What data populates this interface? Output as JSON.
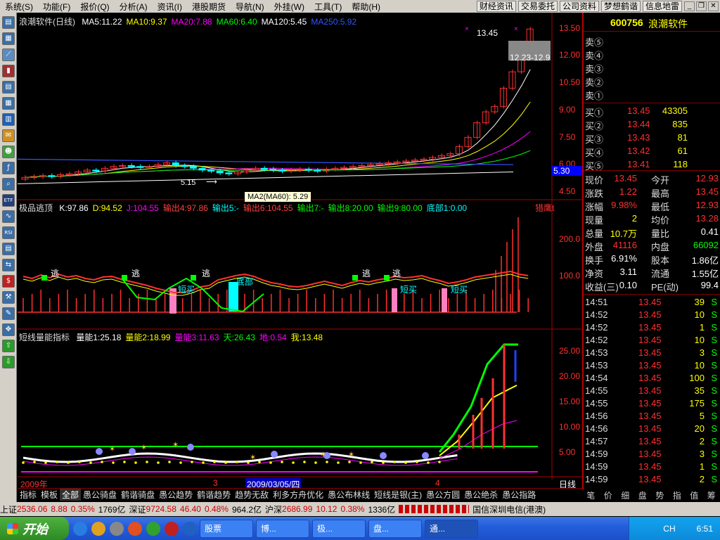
{
  "menubar": {
    "items": [
      "系统(S)",
      "功能(F)",
      "报价(Q)",
      "分析(A)",
      "资讯(I)",
      "港股期货",
      "导航(N)",
      "外挂(W)",
      "工具(T)",
      "帮助(H)"
    ],
    "buttons": [
      "财经资讯",
      "交易委托",
      "公司资料",
      "梦想鹤谐",
      "信息地雷"
    ]
  },
  "main_chart": {
    "title": "浪潮软件(日线)",
    "ma_labels": [
      {
        "text": "MA5:11.22",
        "color": "#ffffff"
      },
      {
        "text": "MA10:9.37",
        "color": "#ffff00"
      },
      {
        "text": "MA20:7.88",
        "color": "#ff00ff"
      },
      {
        "text": "MA60:6.40",
        "color": "#00ff00"
      },
      {
        "text": "MA120:5.45",
        "color": "#ffffff"
      },
      {
        "text": "MA250:5.92",
        "color": "#3355ff"
      }
    ],
    "y_ticks": [
      "13.50",
      "12.00",
      "10.50",
      "9.00",
      "7.50",
      "6.00",
      "4.50"
    ],
    "high_label": "13.45",
    "range_label": "12.23-12.9",
    "low_label": "5.15",
    "price_tag": "5.30",
    "tooltip": "MA2(MA60): 5.29"
  },
  "indicator1": {
    "title": "极品逃顶",
    "labels": [
      {
        "text": "K:97.86",
        "color": "#ffffff"
      },
      {
        "text": "D:94.52",
        "color": "#ffff00"
      },
      {
        "text": "J:104.55",
        "color": "#ff00ff"
      },
      {
        "text": "输出4:97.86",
        "color": "#ff4040"
      },
      {
        "text": "输出5:-",
        "color": "#00ffff"
      },
      {
        "text": "输出6:104.55",
        "color": "#ff4040"
      },
      {
        "text": "输出7:-",
        "color": "#00ff00"
      },
      {
        "text": "输出8:20.00",
        "color": "#00ff00"
      },
      {
        "text": "输出9:80.00",
        "color": "#00ff00"
      },
      {
        "text": "底部1:0.00",
        "color": "#00ffff"
      }
    ],
    "right_label": "猎鹰t",
    "y_ticks": [
      "200.0",
      "100.0"
    ],
    "escape_label": "逃",
    "buy_label": "短买",
    "bottom_label": "底部"
  },
  "indicator2": {
    "title": "短线量能指标",
    "labels": [
      {
        "text": "量能1:25.18",
        "color": "#ffffff"
      },
      {
        "text": "量能2:18.99",
        "color": "#ffff00"
      },
      {
        "text": "量能3:11.63",
        "color": "#ff00ff"
      },
      {
        "text": "天:26.43",
        "color": "#00ff00"
      },
      {
        "text": "地:0.54",
        "color": "#ff00ff"
      },
      {
        "text": "我:13.48",
        "color": "#ffff00"
      }
    ],
    "y_ticks": [
      "25.00",
      "20.00",
      "15.00",
      "10.00",
      "5.00"
    ]
  },
  "timeline": {
    "left": "2009年",
    "mark3": "3",
    "mark4": "4",
    "cursor": "2009/03/05/四",
    "period": "日线"
  },
  "tabs": [
    "指标",
    "模板",
    "全部",
    "愚公骑盘",
    "鹤谐骑盘",
    "愚公趋势",
    "鹤谐趋势",
    "趋势无敌",
    "利多方舟优化",
    "愚公布林线",
    "短线是银(主)",
    "愚公方圆",
    "愚公绝杀",
    "愚公指路"
  ],
  "quote": {
    "code": "600756",
    "name": "浪潮软件",
    "sells": [
      "卖⑤",
      "卖④",
      "卖③",
      "卖②",
      "卖①"
    ],
    "buys": [
      {
        "label": "买①",
        "price": "13.45",
        "vol": "43305"
      },
      {
        "label": "买②",
        "price": "13.44",
        "vol": "835"
      },
      {
        "label": "买③",
        "price": "13.43",
        "vol": "81"
      },
      {
        "label": "买④",
        "price": "13.42",
        "vol": "61"
      },
      {
        "label": "买⑤",
        "price": "13.41",
        "vol": "118"
      }
    ],
    "stats": [
      {
        "l1": "现价",
        "v1": "13.45",
        "c1": "#ff3030",
        "l2": "今开",
        "v2": "12.93",
        "c2": "#ff3030"
      },
      {
        "l1": "涨跌",
        "v1": "1.22",
        "c1": "#ff3030",
        "l2": "最高",
        "v2": "13.45",
        "c2": "#ff3030"
      },
      {
        "l1": "涨幅",
        "v1": "9.98%",
        "c1": "#ff3030",
        "l2": "最低",
        "v2": "12.93",
        "c2": "#ff3030"
      },
      {
        "l1": "现量",
        "v1": "2",
        "c1": "#ffff00",
        "l2": "均价",
        "v2": "13.28",
        "c2": "#ff3030"
      },
      {
        "l1": "总量",
        "v1": "10.7万",
        "c1": "#ffff00",
        "l2": "量比",
        "v2": "0.41",
        "c2": "#ffffff"
      },
      {
        "l1": "外盘",
        "v1": "41116",
        "c1": "#ff3030",
        "l2": "内盘",
        "v2": "66092",
        "c2": "#00ff00"
      },
      {
        "l1": "换手",
        "v1": "6.91%",
        "c1": "#ffffff",
        "l2": "股本",
        "v2": "1.86亿",
        "c2": "#ffffff"
      },
      {
        "l1": "净资",
        "v1": "3.11",
        "c1": "#ffffff",
        "l2": "流通",
        "v2": "1.55亿",
        "c2": "#ffffff"
      },
      {
        "l1": "收益(三)",
        "v1": "0.10",
        "c1": "#ffffff",
        "l2": "PE(动)",
        "v2": "99.4",
        "c2": "#ffffff"
      }
    ],
    "ticks": [
      {
        "t": "14:51",
        "p": "13.45",
        "v": "39",
        "s": "S"
      },
      {
        "t": "14:52",
        "p": "13.45",
        "v": "10",
        "s": "S"
      },
      {
        "t": "14:52",
        "p": "13.45",
        "v": "1",
        "s": "S"
      },
      {
        "t": "14:52",
        "p": "13.45",
        "v": "10",
        "s": "S"
      },
      {
        "t": "14:53",
        "p": "13.45",
        "v": "3",
        "s": "S"
      },
      {
        "t": "14:53",
        "p": "13.45",
        "v": "10",
        "s": "S"
      },
      {
        "t": "14:54",
        "p": "13.45",
        "v": "100",
        "s": "S"
      },
      {
        "t": "14:55",
        "p": "13.45",
        "v": "35",
        "s": "S"
      },
      {
        "t": "14:55",
        "p": "13.45",
        "v": "175",
        "s": "S"
      },
      {
        "t": "14:56",
        "p": "13.45",
        "v": "5",
        "s": "S"
      },
      {
        "t": "14:56",
        "p": "13.45",
        "v": "20",
        "s": "S"
      },
      {
        "t": "14:57",
        "p": "13.45",
        "v": "2",
        "s": "S"
      },
      {
        "t": "14:59",
        "p": "13.45",
        "v": "3",
        "s": "S"
      },
      {
        "t": "14:59",
        "p": "13.45",
        "v": "1",
        "s": "S"
      },
      {
        "t": "14:59",
        "p": "13.45",
        "v": "2",
        "s": "S"
      }
    ],
    "right_tabs": [
      "笔",
      "价",
      "细",
      "盘",
      "势",
      "指",
      "值",
      "筹"
    ]
  },
  "statusbar": {
    "sh_label": "上证",
    "sh_val": "2536.06",
    "sh_chg": "8.88",
    "sh_pct": "0.35%",
    "sh_amt": "1769亿",
    "sz_label": "深证",
    "sz_val": "9724.58",
    "sz_chg": "46.40",
    "sz_pct": "0.48%",
    "sz_amt": "964.2亿",
    "hs_label": "沪深",
    "hs_val": "2686.99",
    "hs_chg": "10.12",
    "hs_pct": "0.38%",
    "hs_amt": "1336亿",
    "conn": "国信深圳电信(港澳)"
  },
  "taskbar": {
    "start": "开始",
    "tasks": [
      "股票",
      "博...",
      "极...",
      "盘...",
      "通..."
    ],
    "lang": "CH",
    "clock": "6:51"
  },
  "chart_data": {
    "type": "candlestick",
    "title": "浪潮软件(日线)",
    "note": "values estimated from y-axis gridlines",
    "closes": [
      5.3,
      5.35,
      5.4,
      5.35,
      5.45,
      5.5,
      5.6,
      5.7,
      5.65,
      5.8,
      5.9,
      5.95,
      5.9,
      5.85,
      5.9,
      6.0,
      6.1,
      5.95,
      5.9,
      5.8,
      5.7,
      5.65,
      5.55,
      5.5,
      5.6,
      5.7,
      5.8,
      5.75,
      5.7,
      5.65,
      5.7,
      5.75,
      5.7,
      5.65,
      5.75,
      5.8,
      5.85,
      5.9,
      5.95,
      6.0,
      6.05,
      6.1,
      6.15,
      6.2,
      6.25,
      6.3,
      6.4,
      6.5,
      6.6,
      7.0,
      7.5,
      8.3,
      8.9,
      9.2,
      10.2,
      11.1,
      12.23,
      13.45
    ],
    "ylim": [
      4.5,
      13.5
    ]
  }
}
